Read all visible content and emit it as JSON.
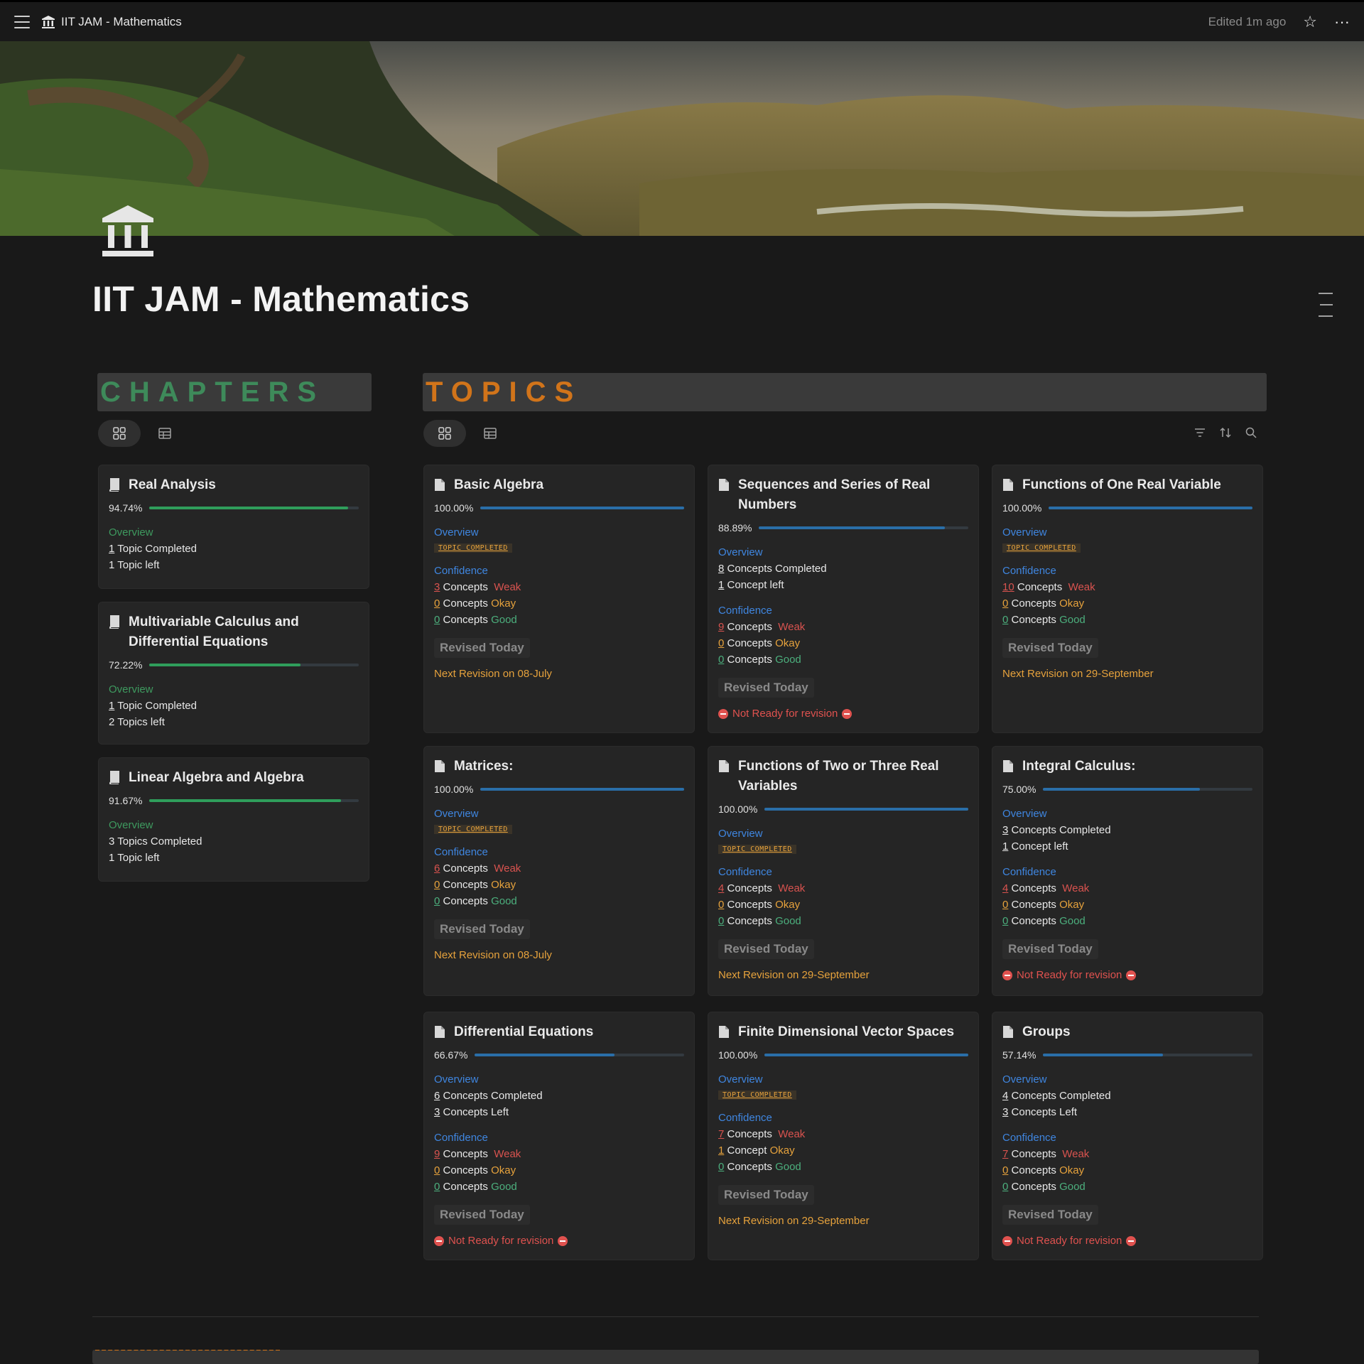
{
  "topbar": {
    "breadcrumb": "IIT JAM - Mathematics",
    "edited": "Edited 1m ago"
  },
  "page": {
    "title": "IIT JAM - Mathematics"
  },
  "chapters": {
    "header": "CHAPTERS",
    "cards": [
      {
        "title": "Real Analysis",
        "progress_text": "94.74%",
        "progress": 0.9474,
        "overview_label": "Overview",
        "line1_num": "1",
        "line1_text": " Topic Completed",
        "line2_text": "1 Topic left"
      },
      {
        "title": "Multivariable Calculus and Differential Equations",
        "progress_text": "72.22%",
        "progress": 0.7222,
        "overview_label": "Overview",
        "line1_num": "1",
        "line1_text": " Topic Completed",
        "line2_text": "2 Topics left"
      },
      {
        "title": "Linear Algebra and Algebra",
        "progress_text": "91.67%",
        "progress": 0.9167,
        "overview_label": "Overview",
        "line1_num": "",
        "line1_text": "3 Topics Completed",
        "line2_text": "1 Topic left"
      }
    ]
  },
  "topics": {
    "header": "TOPICS",
    "common": {
      "overview": "Overview",
      "confidence": "Confidence",
      "badge": "TOPIC COMPLETED",
      "revised": "Revised Today",
      "not_ready": "Not Ready for revision",
      "concepts": "Concepts",
      "concept": "Concept",
      "weak": "Weak",
      "okay": "Okay",
      "good": "Good",
      "concepts_completed": "Concepts Completed",
      "concept_left": "Concept left",
      "concepts_left": "Concepts Left"
    },
    "cards": [
      {
        "title": "Basic Algebra",
        "progress_text": "100.00%",
        "progress": 1.0,
        "weak": "3",
        "okay": "0",
        "good": "0",
        "next": "Next Revision on 08-July"
      },
      {
        "title": "Sequences and Series of Real Numbers",
        "progress_text": "88.89%",
        "progress": 0.8889,
        "completed": "8",
        "left": "1",
        "weak": "9",
        "okay": "0",
        "good": "0"
      },
      {
        "title": "Functions of One Real Variable",
        "progress_text": "100.00%",
        "progress": 1.0,
        "weak": "10",
        "okay": "0",
        "good": "0",
        "next": "Next Revision on 29-September"
      },
      {
        "title": "Matrices:",
        "progress_text": "100.00%",
        "progress": 1.0,
        "weak": "6",
        "okay": "0",
        "good": "0",
        "next": "Next Revision on 08-July"
      },
      {
        "title": "Functions of Two or Three Real Variables",
        "progress_text": "100.00%",
        "progress": 1.0,
        "weak": "4",
        "okay": "0",
        "good": "0",
        "next": "Next Revision on 29-September"
      },
      {
        "title": "Integral Calculus:",
        "progress_text": "75.00%",
        "progress": 0.75,
        "completed": "3",
        "left": "1",
        "weak": "4",
        "okay": "0",
        "good": "0"
      },
      {
        "title": "Differential Equations",
        "progress_text": "66.67%",
        "progress": 0.6667,
        "completed": "6",
        "left": "3",
        "weak": "9",
        "okay": "0",
        "good": "0"
      },
      {
        "title": "Finite Dimensional Vector Spaces",
        "progress_text": "100.00%",
        "progress": 1.0,
        "weak": "7",
        "okay": "1",
        "good": "0",
        "next": "Next Revision on 29-September"
      },
      {
        "title": "Groups",
        "progress_text": "57.14%",
        "progress": 0.5714,
        "completed": "4",
        "left": "3",
        "weak": "7",
        "okay": "0",
        "good": "0"
      }
    ]
  },
  "colors": {
    "chapters_accent": "#3e8a5a",
    "topics_accent": "#d1741a",
    "chapter_bar": "#2f9e5b",
    "topic_bar": "#2a6ea8",
    "overview_blue": "#3f86e0",
    "overview_green": "#3e9a5f"
  },
  "icons": [
    "menu-icon",
    "bank-icon",
    "star-icon",
    "more-icon",
    "gallery-view-icon",
    "table-view-icon",
    "filter-icon",
    "sort-icon",
    "search-icon",
    "book-icon",
    "page-icon",
    "no-entry-icon"
  ]
}
